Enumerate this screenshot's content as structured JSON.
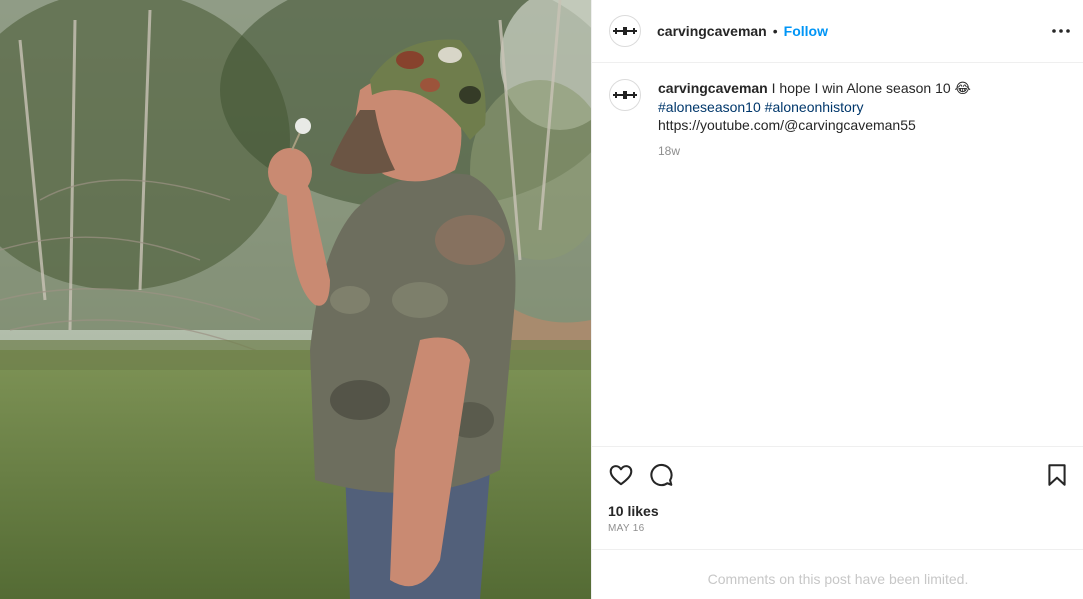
{
  "post": {
    "author": {
      "username": "carvingcaveman",
      "follow_label": "Follow",
      "separator": "•"
    },
    "caption": {
      "username": "carvingcaveman",
      "text": "I hope I win Alone season 10",
      "emoji": "😂",
      "hashtags": [
        "#aloneseason10",
        "#aloneonhistory"
      ],
      "link": "https://youtube.com/@carvingcaveman55",
      "time_ago": "18w"
    },
    "likes": "10 likes",
    "date": "MAY 16",
    "comments_notice": "Comments on this post have been limited.",
    "icons": {
      "more": "more-horizontal-icon",
      "like": "heart-icon",
      "comment": "comment-bubble-icon",
      "save": "bookmark-icon"
    },
    "colors": {
      "accent": "#0095f6",
      "hashtag": "#00376b",
      "muted": "#8e8e8e",
      "text": "#262626",
      "limited": "#c7c7c7"
    }
  }
}
